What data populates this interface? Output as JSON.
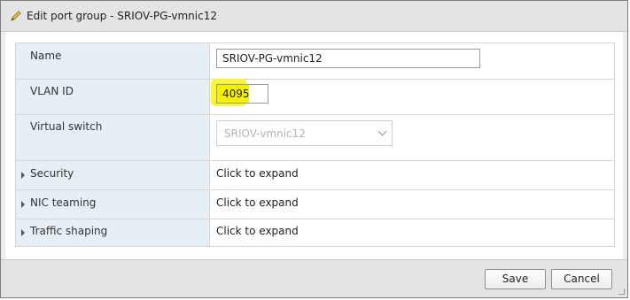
{
  "dialog": {
    "title": "Edit port group - SRIOV-PG-vmnic12",
    "title_icon": "pencil-icon"
  },
  "form": {
    "name": {
      "label": "Name",
      "value": "SRIOV-PG-vmnic12"
    },
    "vlan": {
      "label": "VLAN ID",
      "value": "4095",
      "highlight_color": "#f3f000"
    },
    "vswitch": {
      "label": "Virtual switch",
      "value": "SRIOV-vmnic12",
      "disabled": true
    },
    "security": {
      "label": "Security",
      "value": "Click to expand"
    },
    "nic_teaming": {
      "label": "NIC teaming",
      "value": "Click to expand"
    },
    "traffic_shaping": {
      "label": "Traffic shaping",
      "value": "Click to expand"
    }
  },
  "footer": {
    "save_label": "Save",
    "cancel_label": "Cancel"
  },
  "colors": {
    "label_bg": "#e6eff5",
    "titlebar_bg": "#e4e4e4",
    "border": "#d6d6d6"
  }
}
